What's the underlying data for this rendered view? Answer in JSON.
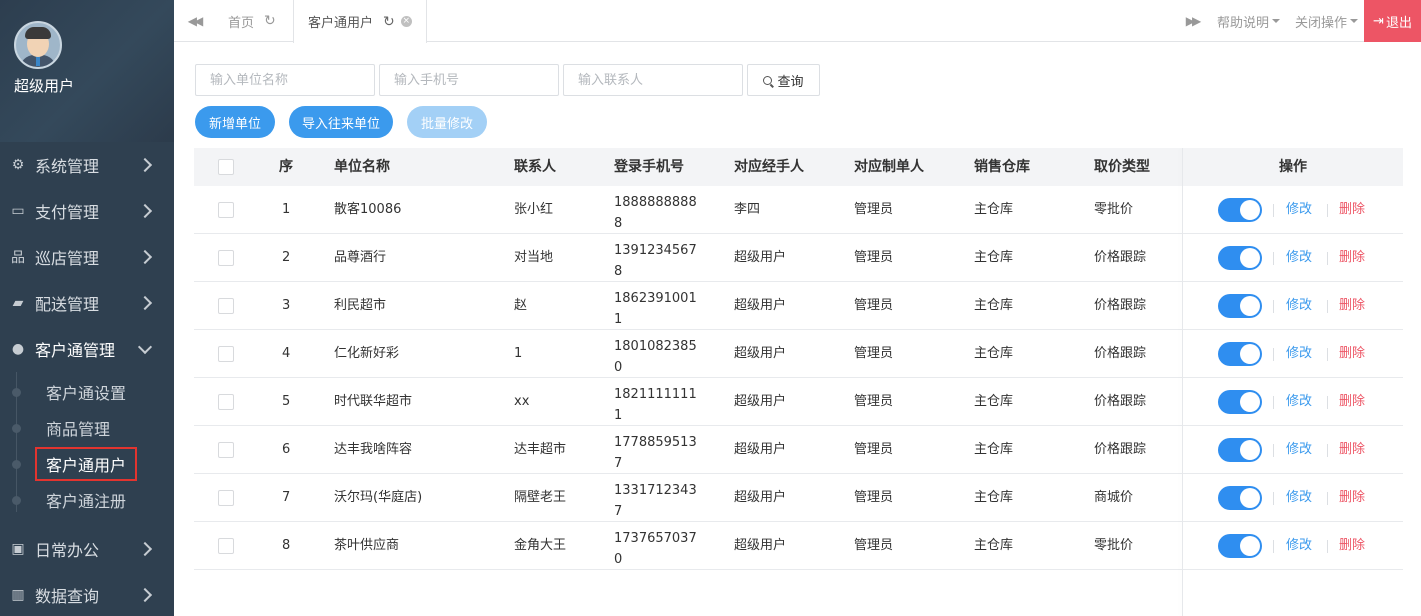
{
  "user": {
    "name": "超级用户"
  },
  "sidebar": {
    "items": [
      {
        "label": "系统管理",
        "icon": "gears-icon"
      },
      {
        "label": "支付管理",
        "icon": "credit-card-icon"
      },
      {
        "label": "巡店管理",
        "icon": "sitemap-icon"
      },
      {
        "label": "配送管理",
        "icon": "truck-icon"
      },
      {
        "label": "客户通管理",
        "icon": "users-icon",
        "open": true
      },
      {
        "label": "日常办公",
        "icon": "briefcase-icon"
      },
      {
        "label": "数据查询",
        "icon": "bar-chart-icon"
      }
    ],
    "subitems": [
      {
        "label": "客户通设置"
      },
      {
        "label": "商品管理"
      },
      {
        "label": "客户通用户",
        "active": true
      },
      {
        "label": "客户通注册"
      }
    ]
  },
  "tabs": {
    "home": "首页",
    "current": "客户通用户",
    "help": "帮助说明",
    "close_ops": "关闭操作",
    "logout": "退出"
  },
  "search": {
    "unit_placeholder": "输入单位名称",
    "phone_placeholder": "输入手机号",
    "contact_placeholder": "输入联系人",
    "query_label": "查询"
  },
  "actions": {
    "add_unit": "新增单位",
    "import_unit": "导入往来单位",
    "batch_edit": "批量修改"
  },
  "table": {
    "headers": {
      "seq": "序",
      "unit": "单位名称",
      "contact": "联系人",
      "phone": "登录手机号",
      "handler": "对应经手人",
      "maker": "对应制单人",
      "warehouse": "销售仓库",
      "price": "取价类型",
      "ops": "操作"
    },
    "edit_label": "修改",
    "delete_label": "删除",
    "rows": [
      {
        "seq": "1",
        "unit": "散客10086",
        "contact": "张小红",
        "phone": "18888888888",
        "handler": "李四",
        "maker": "管理员",
        "warehouse": "主仓库",
        "price": "零批价",
        "enabled": true
      },
      {
        "seq": "2",
        "unit": "品尊酒行",
        "contact": "对当地",
        "phone": "13912345678",
        "handler": "超级用户",
        "maker": "管理员",
        "warehouse": "主仓库",
        "price": "价格跟踪",
        "enabled": true
      },
      {
        "seq": "3",
        "unit": "利民超市",
        "contact": "赵",
        "phone": "18623910011",
        "handler": "超级用户",
        "maker": "管理员",
        "warehouse": "主仓库",
        "price": "价格跟踪",
        "enabled": true
      },
      {
        "seq": "4",
        "unit": "仁化新好彩",
        "contact": "1",
        "phone": "18010823850",
        "handler": "超级用户",
        "maker": "管理员",
        "warehouse": "主仓库",
        "price": "价格跟踪",
        "enabled": true
      },
      {
        "seq": "5",
        "unit": "时代联华超市",
        "contact": "xx",
        "phone": "18211111111",
        "handler": "超级用户",
        "maker": "管理员",
        "warehouse": "主仓库",
        "price": "价格跟踪",
        "enabled": true
      },
      {
        "seq": "6",
        "unit": "达丰我啥阵容",
        "contact": "达丰超市",
        "phone": "17788595137",
        "handler": "超级用户",
        "maker": "管理员",
        "warehouse": "主仓库",
        "price": "价格跟踪",
        "enabled": true
      },
      {
        "seq": "7",
        "unit": "沃尔玛(华庭店)",
        "contact": "隔壁老王",
        "phone": "13317123437",
        "handler": "超级用户",
        "maker": "管理员",
        "warehouse": "主仓库",
        "price": "商城价",
        "enabled": true
      },
      {
        "seq": "8",
        "unit": "茶叶供应商",
        "contact": "金角大王",
        "phone": "17376570370",
        "handler": "超级用户",
        "maker": "管理员",
        "warehouse": "主仓库",
        "price": "零批价",
        "enabled": true
      }
    ]
  }
}
